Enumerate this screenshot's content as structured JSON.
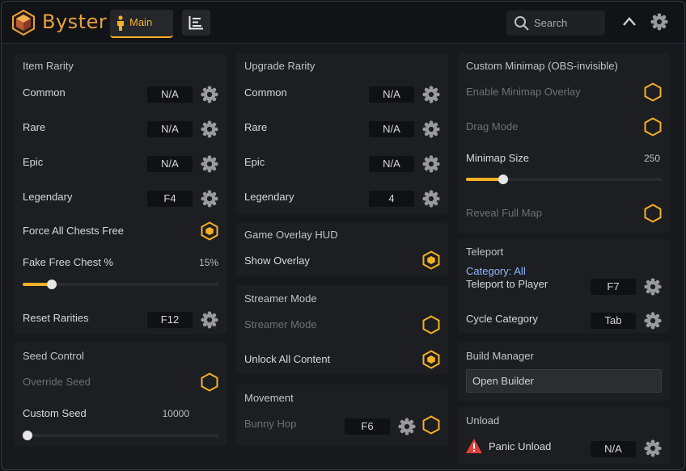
{
  "app": {
    "title": "Byster"
  },
  "tabs": {
    "main_label": "Main"
  },
  "search": {
    "placeholder": "Search"
  },
  "item_rarity": {
    "title": "Item Rarity",
    "rows": [
      {
        "label": "Common",
        "key": "N/A"
      },
      {
        "label": "Rare",
        "key": "N/A"
      },
      {
        "label": "Epic",
        "key": "N/A"
      },
      {
        "label": "Legendary",
        "key": "F4"
      }
    ],
    "force_free_label": "Force All Chests Free",
    "fake_free_label": "Fake Free Chest %",
    "fake_free_value": "15%",
    "fake_free_level": 0.15,
    "reset_label": "Reset Rarities",
    "reset_key": "F12"
  },
  "seed_control": {
    "title": "Seed Control",
    "override_label": "Override Seed",
    "custom_label": "Custom Seed",
    "custom_value": "10000",
    "custom_level": 0.0
  },
  "upgrade_rarity": {
    "title": "Upgrade Rarity",
    "rows": [
      {
        "label": "Common",
        "key": "N/A"
      },
      {
        "label": "Rare",
        "key": "N/A"
      },
      {
        "label": "Epic",
        "key": "N/A"
      },
      {
        "label": "Legendary",
        "key": "4"
      }
    ]
  },
  "game_overlay": {
    "title": "Game Overlay HUD",
    "show_label": "Show Overlay"
  },
  "streamer_mode": {
    "title": "Streamer Mode",
    "streamer_label": "Streamer Mode",
    "unlock_label": "Unlock All Content"
  },
  "movement": {
    "title": "Movement",
    "bunny_label": "Bunny Hop",
    "bunny_key": "F6"
  },
  "minimap": {
    "title": "Custom Minimap (OBS-invisible)",
    "enable_label": "Enable Minimap Overlay",
    "drag_label": "Drag Mode",
    "size_label": "Minimap Size",
    "size_value": "250",
    "size_level": 0.19,
    "reveal_label": "Reveal Full Map"
  },
  "teleport": {
    "title": "Teleport",
    "category_label": "Category: All",
    "to_player_label": "Teleport to Player",
    "to_player_key": "F7",
    "cycle_label": "Cycle Category",
    "cycle_key": "Tab"
  },
  "build_manager": {
    "title": "Build Manager",
    "open_label": "Open Builder"
  },
  "unload": {
    "title": "Unload",
    "panic_label": "Panic Unload",
    "panic_key": "N/A"
  },
  "colors": {
    "accent": "#f5b025",
    "category_text": "#8fb8ff",
    "warning": "#e0403a"
  }
}
